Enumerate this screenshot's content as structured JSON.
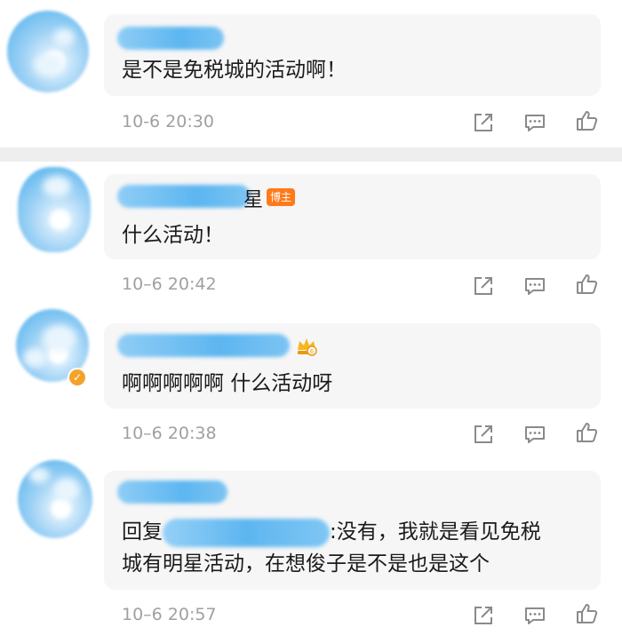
{
  "comments": [
    {
      "text": "是不是免税城的活动啊！",
      "time": "10-6 20:30",
      "name_tail": ""
    },
    {
      "text": "什么活动！",
      "time": "10–6 20:42",
      "name_tail": "星",
      "badge": "博主"
    },
    {
      "text": "啊啊啊啊啊 什么活动呀",
      "time": "10–6 20:38"
    },
    {
      "reply_label": "回复",
      "line1_tail": ":没有，我就是看见免税",
      "line2": "城有明星活动，在想俊子是不是也是这个",
      "time": "10–6 20:57"
    }
  ],
  "icons": {
    "share": "share-icon",
    "reply": "comment-icon",
    "like": "thumbs-up-icon",
    "verified": "verified-badge-icon",
    "crown": "crown-badge-icon"
  },
  "colors": {
    "bubble": "#f6f6f6",
    "divider": "#eeeeee",
    "timestamp": "#a0a0a0",
    "author_badge": "#ff7a1a",
    "verified": "#f4a32a",
    "blur": "#5cb6f0"
  }
}
